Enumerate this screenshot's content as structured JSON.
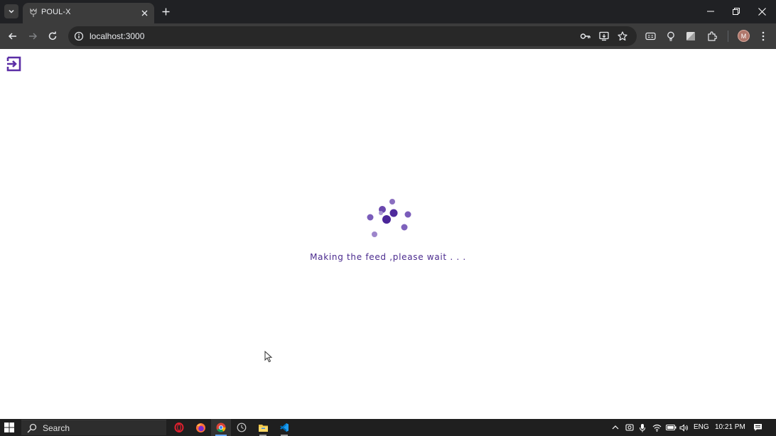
{
  "browser": {
    "tab": {
      "title": "POUL-X",
      "favicon": "tulip-icon"
    },
    "url": "localhost:3000",
    "profile_initial": "M"
  },
  "page": {
    "loading_message": "Making the feed ,please wait . . .",
    "accent_color": "#5b2ea6"
  },
  "taskbar": {
    "search_label": "Search",
    "language": "ENG",
    "time": "10:21 PM",
    "apps": [
      "opera-icon",
      "firefox-icon",
      "chrome-icon",
      "clock-icon",
      "file-explorer-icon",
      "vscode-icon"
    ]
  }
}
